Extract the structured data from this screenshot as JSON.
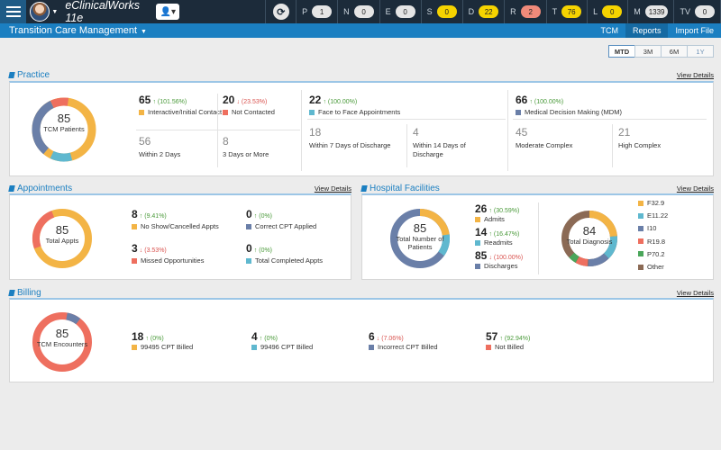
{
  "app": {
    "brand": "eClinicalWorks 11e",
    "page_title": "Transition Care Management",
    "tabs": [
      "TCM",
      "Reports",
      "Import File"
    ]
  },
  "counters": [
    {
      "label": "P",
      "value": "1",
      "color": "#e5e5e5"
    },
    {
      "label": "N",
      "value": "0",
      "color": "#e5e5e5"
    },
    {
      "label": "E",
      "value": "0",
      "color": "#e5e5e5"
    },
    {
      "label": "S",
      "value": "0",
      "color": "#f5d300"
    },
    {
      "label": "D",
      "value": "22",
      "color": "#f5d300"
    },
    {
      "label": "R",
      "value": "2",
      "color": "#f08a7a"
    },
    {
      "label": "T",
      "value": "76",
      "color": "#f5d300"
    },
    {
      "label": "L",
      "value": "0",
      "color": "#f5d300"
    },
    {
      "label": "M",
      "value": "1339",
      "color": "#e5e5e5"
    },
    {
      "label": "TV",
      "value": "0",
      "color": "#e5e5e5"
    }
  ],
  "period": [
    "MTD",
    "3M",
    "6M",
    "1Y"
  ],
  "sections": {
    "practice": {
      "title": "Practice",
      "view": "View Details",
      "donut_total": "85",
      "donut_label": "TCM Patients",
      "metrics": [
        {
          "num": "65",
          "change": "(101.56%)",
          "dir": "up",
          "label": "Interactive/Initial Contact",
          "color": "#f3b445"
        },
        {
          "num": "20",
          "change": "(23.53%)",
          "dir": "down",
          "label": "Not Contacted",
          "color": "#ee6f5f"
        },
        {
          "num": "56",
          "label": "Within 2 Days"
        },
        {
          "num": "8",
          "label": "3 Days or More"
        },
        {
          "num": "22",
          "change": "(100.00%)",
          "dir": "up",
          "label": "Face to Face Appointments",
          "color": "#5fb8cf"
        },
        {
          "num": "18",
          "label": "Within 7 Days of Discharge"
        },
        {
          "num": "4",
          "label": "Within 14 Days of Discharge"
        },
        {
          "num": "66",
          "change": "(100.00%)",
          "dir": "up",
          "label": "Medical Decision Making (MDM)",
          "color": "#6a7fa8"
        },
        {
          "num": "45",
          "label": "Moderate Complex"
        },
        {
          "num": "21",
          "label": "High Complex"
        }
      ]
    },
    "appointments": {
      "title": "Appointments",
      "view": "View Details",
      "donut_total": "85",
      "donut_label": "Total Appts",
      "metrics": [
        {
          "num": "8",
          "change": "(9.41%)",
          "dir": "up",
          "label": "No Show/Cancelled Appts",
          "color": "#f3b445"
        },
        {
          "num": "0",
          "change": "(0%)",
          "dir": "up",
          "label": "Correct CPT Applied",
          "color": "#6a7fa8"
        },
        {
          "num": "3",
          "change": "(3.53%)",
          "dir": "down",
          "label": "Missed Opportunities",
          "color": "#ee6f5f"
        },
        {
          "num": "0",
          "change": "(0%)",
          "dir": "up",
          "label": "Total Completed Appts",
          "color": "#5fb8cf"
        }
      ]
    },
    "hospital": {
      "title": "Hospital Facilities",
      "view": "View Details",
      "donut_total": "85",
      "donut_label": "Total Number of Patients",
      "metrics": [
        {
          "num": "26",
          "change": "(30.59%)",
          "dir": "up",
          "label": "Admits",
          "color": "#f3b445"
        },
        {
          "num": "14",
          "change": "(16.47%)",
          "dir": "up",
          "label": "Readmits",
          "color": "#5fb8cf"
        },
        {
          "num": "85",
          "change": "(100.00%)",
          "dir": "down",
          "label": "Discharges",
          "color": "#6a7fa8"
        }
      ],
      "diag_total": "84",
      "diag_label": "Total Diagnosis",
      "legend": [
        {
          "label": "F32.9",
          "color": "#f3b445"
        },
        {
          "label": "E11.22",
          "color": "#5fb8cf"
        },
        {
          "label": "I10",
          "color": "#6a7fa8"
        },
        {
          "label": "R19.8",
          "color": "#ee6f5f"
        },
        {
          "label": "P70.2",
          "color": "#4aa65a"
        },
        {
          "label": "Other",
          "color": "#8b6a55"
        }
      ]
    },
    "billing": {
      "title": "Billing",
      "view": "View Details",
      "donut_total": "85",
      "donut_label": "TCM Encounters",
      "metrics": [
        {
          "num": "18",
          "change": "(0%)",
          "dir": "up",
          "label": "99495 CPT Billed",
          "color": "#f3b445"
        },
        {
          "num": "4",
          "change": "(0%)",
          "dir": "up",
          "label": "99496 CPT Billed",
          "color": "#5fb8cf"
        },
        {
          "num": "6",
          "change": "(7.06%)",
          "dir": "down",
          "label": "Incorrect CPT Billed",
          "color": "#6a7fa8"
        },
        {
          "num": "57",
          "change": "(92.94%)",
          "dir": "up",
          "label": "Not Billed",
          "color": "#ee6f5f"
        }
      ]
    }
  }
}
